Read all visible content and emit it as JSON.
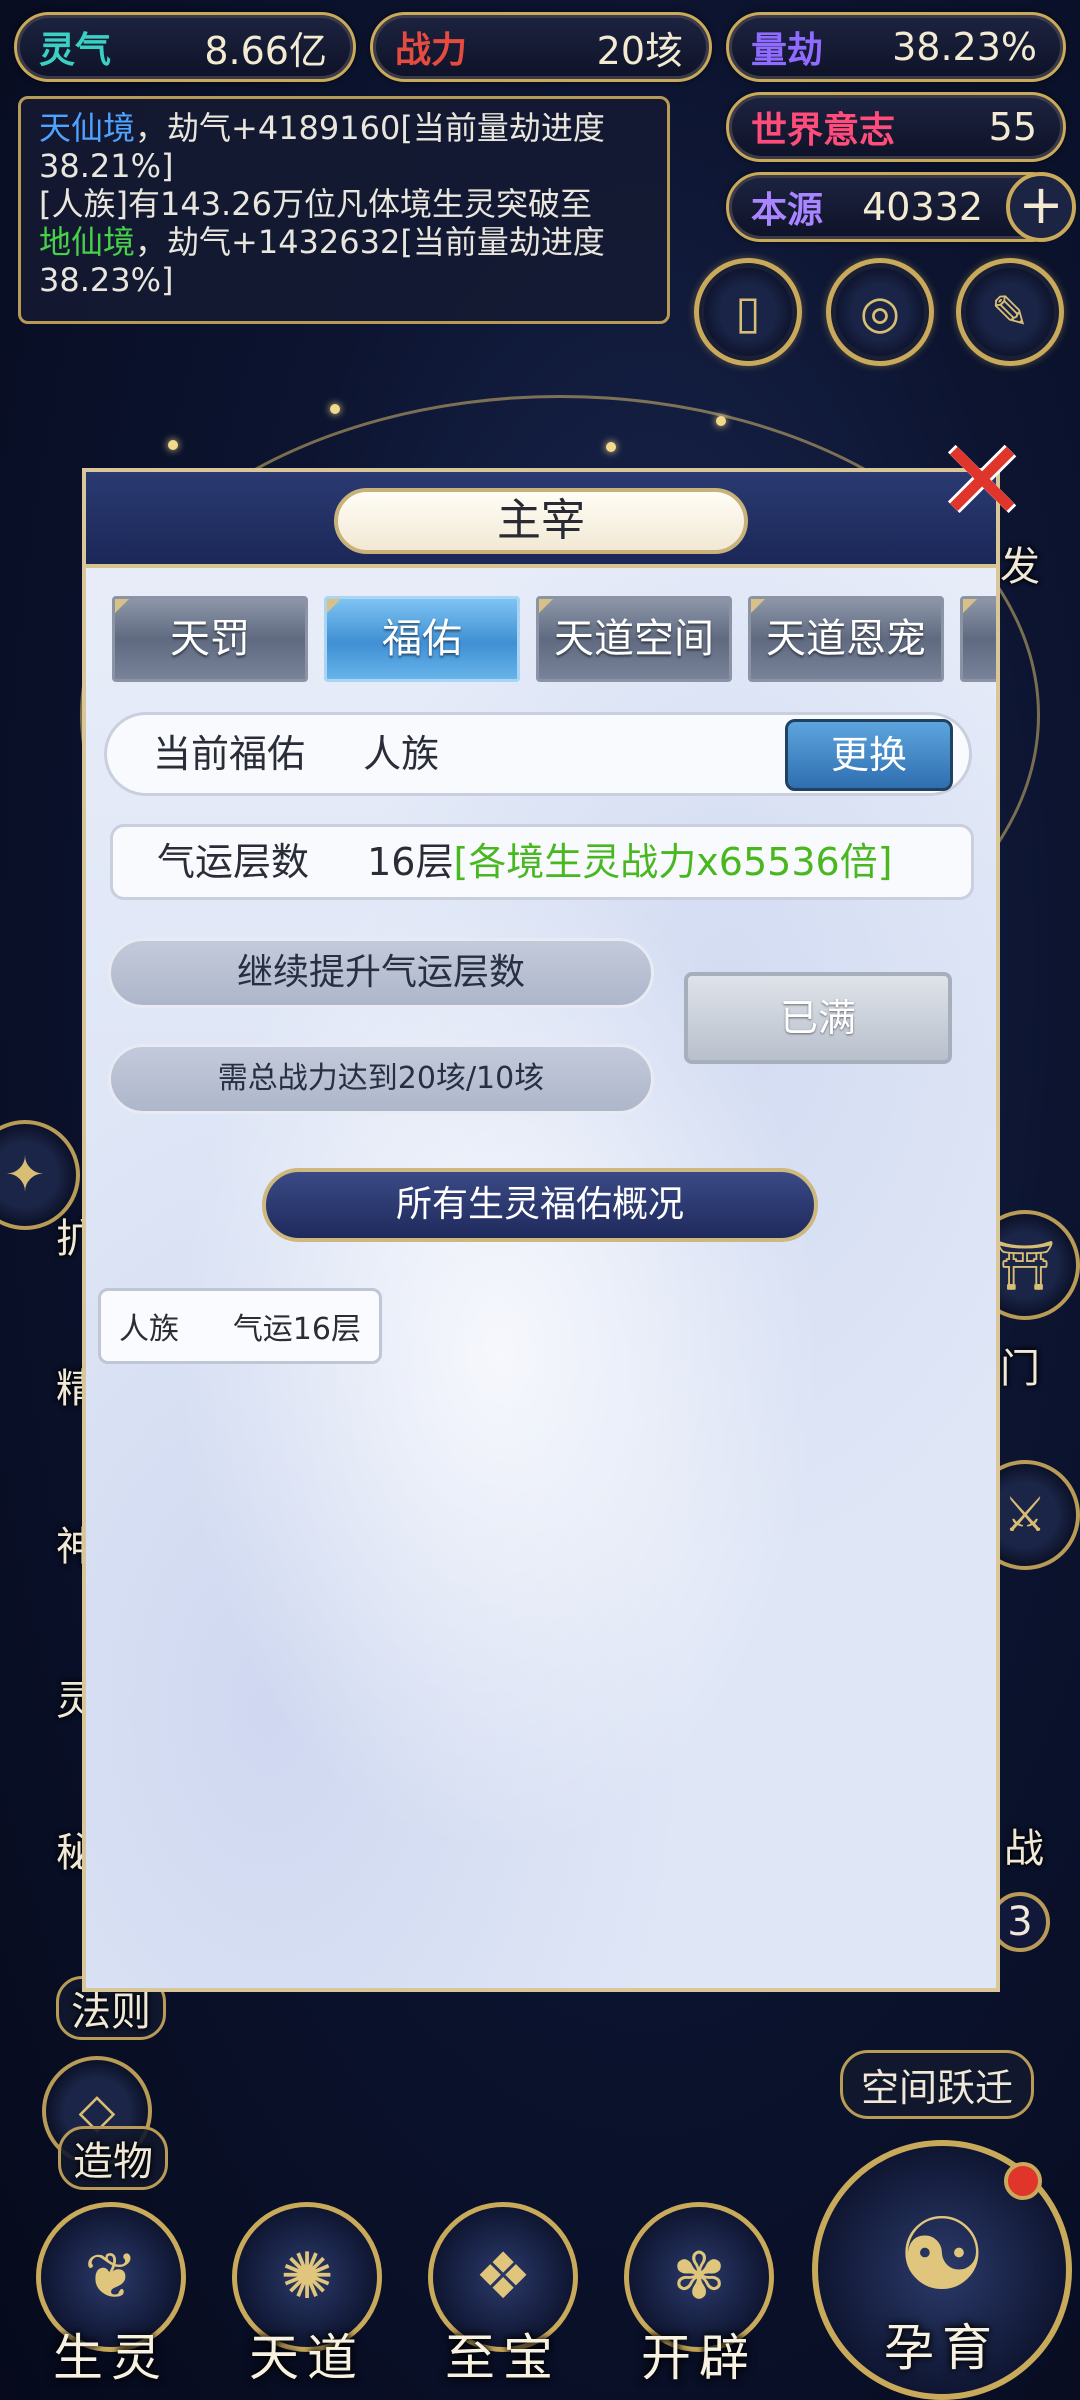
{
  "stats": {
    "lingqi": {
      "label": "灵气",
      "value": "8.66亿",
      "color": "#3bd1c2"
    },
    "zhanli": {
      "label": "战力",
      "value": "20垓",
      "color": "#e64b3f"
    },
    "liangjie": {
      "label": "量劫",
      "value": "38.23%",
      "color": "#8f6bff"
    },
    "shijie": {
      "label": "世界意志",
      "value": "55",
      "color": "#ff4c7a"
    },
    "benyuan": {
      "label": "本源",
      "value": "40332",
      "color": "#a986ff"
    }
  },
  "log": {
    "line1_realm": "天仙境",
    "line1_text": "，劫气+4189160[当前量劫进度38.21%]",
    "line2_text": "[人族]有143.26万位凡体境生灵突破至",
    "line2_realm": "地仙境",
    "line2_tail": "，劫气+1432632[当前量劫进度38.23%]"
  },
  "side": {
    "right_fa": "发",
    "right_men": "门",
    "right_zhan": "战",
    "right_3": "3",
    "left_kuo": "扩",
    "left_jing": "精",
    "left_shen": "神",
    "left_ling": "灵",
    "left_mi": "秘",
    "fazhe": "法则",
    "zaowu": "造物",
    "kongjian": "空间跃迁"
  },
  "nav": {
    "shengling": "生灵",
    "tiandao": "天道",
    "zhibao": "至宝",
    "kaipi": "开辟",
    "yunyu": "孕育"
  },
  "modal": {
    "title": "主宰",
    "tabs": [
      "天罚",
      "福佑",
      "天道空间",
      "天道恩宠"
    ],
    "active_tab": "福佑",
    "current_label": "当前福佑",
    "current_value": "人族",
    "swap_label": "更换",
    "fortune_label": "气运层数",
    "fortune_value": "16层",
    "fortune_bonus": "[各境生灵战力x65536倍]",
    "continue_label": "继续提升气运层数",
    "requirement": "需总战力达到20垓/10垓",
    "full_label": "已满",
    "overview_label": "所有生灵福佑概况",
    "race_name": "人族",
    "race_fortune": "气运16层"
  }
}
